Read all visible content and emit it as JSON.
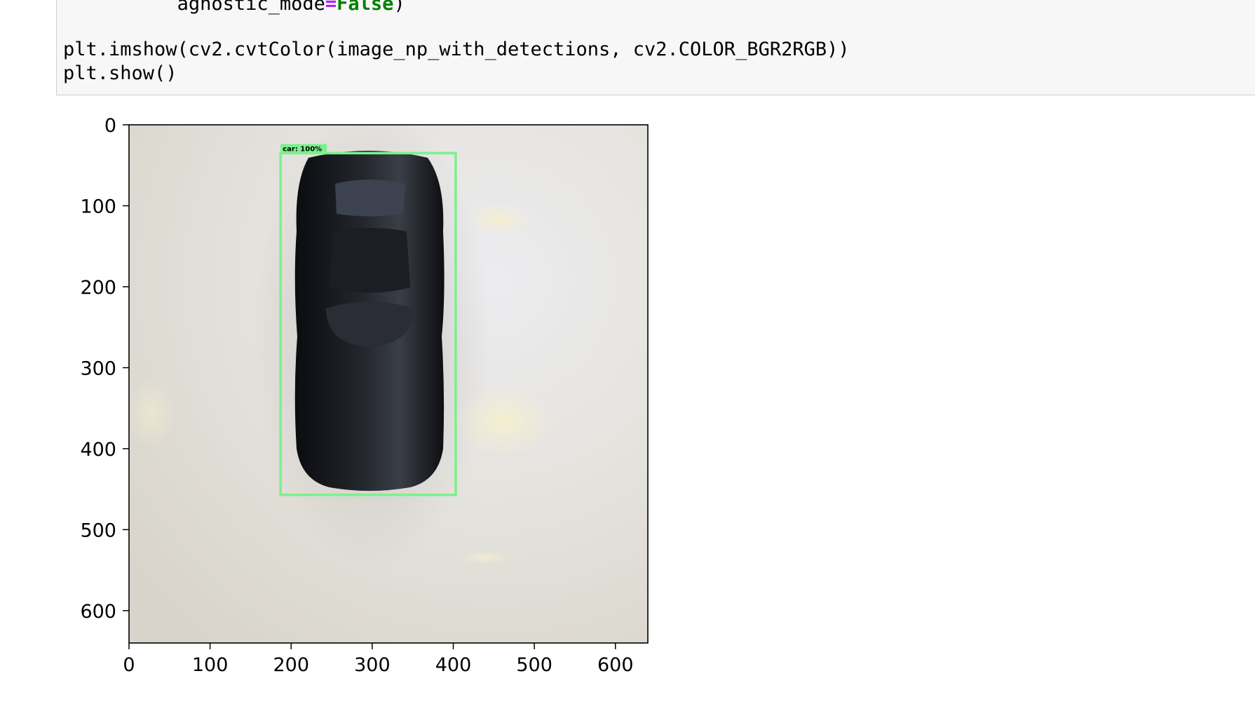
{
  "code_cell": {
    "lines": [
      {
        "indent": "          ",
        "arg": "agnostic_mode",
        "op": "=",
        "value": "False",
        "close": ")"
      },
      {
        "text": ""
      },
      {
        "text": "plt.imshow(cv2.cvtColor(image_np_with_detections, cv2.COLOR_BGR2RGB))"
      },
      {
        "text": "plt.show()"
      }
    ]
  },
  "chart_data": {
    "type": "image",
    "xlim": [
      0,
      640
    ],
    "ylim": [
      640,
      0
    ],
    "x_ticks": [
      0,
      100,
      200,
      300,
      400,
      500,
      600
    ],
    "y_ticks": [
      0,
      100,
      200,
      300,
      400,
      500,
      600
    ],
    "detections": [
      {
        "label": "car: 100%",
        "box": {
          "xmin": 187,
          "ymin": 35,
          "xmax": 403,
          "ymax": 457
        },
        "color": "#7cf08c"
      }
    ]
  },
  "colors": {
    "background_light": "#e6e4de",
    "car": "#14161c",
    "box": "#7cf08c"
  }
}
